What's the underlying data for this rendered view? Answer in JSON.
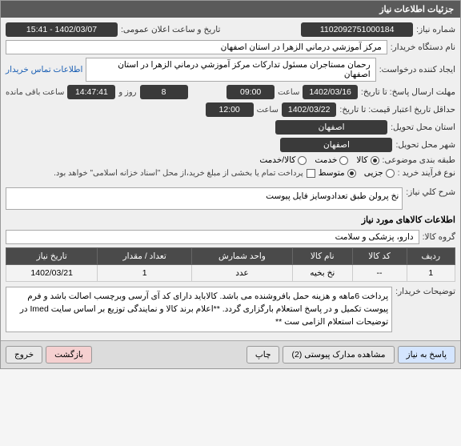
{
  "header": {
    "title": "جزئیات اطلاعات نیاز"
  },
  "fields": {
    "need_number_label": "شماره نیاز:",
    "need_number": "1102092751000184",
    "announce_label": "تاریخ و ساعت اعلان عمومی:",
    "announce_value": "1402/03/07 - 15:41",
    "buyer_label": "نام دستگاه خریدار:",
    "buyer_value": "مرکز آموزشي درماني الزهرا در استان اصفهان",
    "requester_label": "ایجاد کننده درخواست:",
    "requester_value": "رحمان مستاجران مسئول تدارکات مرکز آموزشي درماني الزهرا در استان اصفهان",
    "contact_link": "اطلاعات تماس خریدار",
    "deadline_label": "مهلت ارسال پاسخ: تا تاریخ:",
    "deadline_date": "1402/03/16",
    "time_label": "ساعت",
    "deadline_time": "09:00",
    "days_count": "8",
    "days_label": "روز و",
    "remain_time": "14:47:41",
    "remain_label": "ساعت باقی مانده",
    "credit_label": "حداقل تاریخ اعتبار قیمت: تا تاریخ:",
    "credit_date": "1402/03/22",
    "credit_time": "12:00",
    "province_label": "استان محل تحویل:",
    "province_value": "اصفهان",
    "city_label": "شهر محل تحویل:",
    "city_value": "اصفهان",
    "category_label": "طبقه بندی موضوعی:",
    "cat_goods": "کالا",
    "cat_service": "خدمت",
    "cat_goods_service": "کالا/خدمت",
    "buy_type_label": "نوع فرآیند خرید :",
    "buy_partial": "جزیی",
    "buy_medium": "متوسط",
    "payment_note": "پرداخت تمام یا بخشی از مبلغ خرید،از محل \"اسناد خزانه اسلامی\" خواهد بود.",
    "desc_label": "شرح کلي نیاز:",
    "desc_value": "نخ پرولن طبق تعدادوسایز فایل پیوست",
    "goods_section": "اطلاعات کالاهای مورد نیاز",
    "goods_group_label": "گروه کالا:",
    "goods_group_value": "دارو، پزشکی و سلامت",
    "buyer_notes_label": "توضیحات خریدار:",
    "buyer_notes_value": "پرداخت 6ماهه و هزینه حمل بافروشنده می باشد. کالاباید دارای کد آی آرسی وبرچسب اصالت باشد و فرم پیوست تکمیل و در پاسخ استعلام بارگزاری گردد. **اعلام برند کالا و نمایندگی توزیع بر اساس سایت Imed در توضیحات استعلام الزامی ست **"
  },
  "table": {
    "headers": {
      "row": "ردیف",
      "code": "کد کالا",
      "name": "نام کالا",
      "unit": "واحد شمارش",
      "qty": "تعداد / مقدار",
      "date": "تاریخ نیاز"
    },
    "rows": [
      {
        "row": "1",
        "code": "--",
        "name": "نخ بخیه",
        "unit": "عدد",
        "qty": "1",
        "date": "1402/03/21"
      }
    ]
  },
  "footer": {
    "reply": "پاسخ به نیاز",
    "attachments": "مشاهده مدارک پیوستی (2)",
    "print": "چاپ",
    "back": "بازگشت",
    "exit": "خروج"
  }
}
